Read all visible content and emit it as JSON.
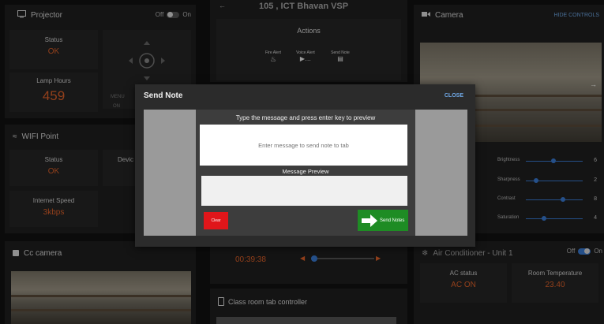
{
  "projector": {
    "title": "Projector",
    "toggle_off": "Off",
    "toggle_on": "On",
    "status_label": "Status",
    "status_value": "OK",
    "lamp_label": "Lamp Hours",
    "lamp_value": "459",
    "menu_label": "MENU",
    "menu_sub": "ON"
  },
  "classroom": {
    "title": "105 , ICT Bhavan VSP",
    "actions_label": "Actions",
    "actions": [
      {
        "label": "Fire Alert",
        "icon": "fire-icon"
      },
      {
        "label": "Voice Alert",
        "icon": "megaphone-icon"
      },
      {
        "label": "Send Note",
        "icon": "note-icon"
      }
    ],
    "timer": "00:39:38",
    "tab_controller": "Class room tab controller"
  },
  "camera": {
    "title": "Camera",
    "hide_controls": "HIDE CONTROLS",
    "controls": [
      {
        "label": "Brightness",
        "value": "6",
        "level": 0.45
      },
      {
        "label": "Sharpness",
        "value": "2",
        "level": 0.15
      },
      {
        "label": "Contrast",
        "value": "8",
        "level": 0.62
      },
      {
        "label": "Saturation",
        "value": "4",
        "level": 0.3
      }
    ]
  },
  "wifi": {
    "title": "WIFI Point",
    "status_label": "Status",
    "status_value": "OK",
    "device_label": "Devic",
    "speed_label": "Internet Speed",
    "speed_value": "3kbps"
  },
  "cc_camera": {
    "title": "Cc camera"
  },
  "air_conditioner": {
    "title": "Air Conditioner - Unit 1",
    "toggle_off": "Off",
    "toggle_on": "On",
    "status_label": "AC status",
    "status_value": "AC ON",
    "temp_label": "Room Temperature",
    "temp_value": "23.40"
  },
  "modal": {
    "title": "Send Note",
    "close_label": "CLOSE",
    "hint": "Type the message and press enter key to preview",
    "input_placeholder": "Enter message to send note to tab",
    "preview_label": "Message Preview",
    "clear_label": "Clear",
    "send_label": "Send Notes"
  }
}
